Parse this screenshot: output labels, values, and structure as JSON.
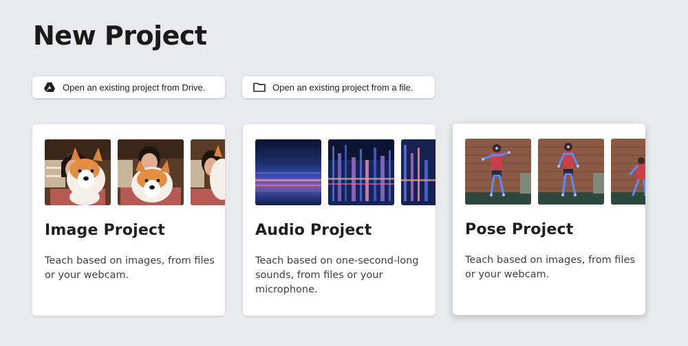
{
  "page": {
    "title": "New Project"
  },
  "actions": {
    "drive_label": "Open an existing project from Drive.",
    "file_label": "Open an existing project from a file."
  },
  "icons": {
    "drive": "google-drive-icon",
    "file": "folder-icon"
  },
  "projects": [
    {
      "title": "Image Project",
      "description": "Teach based on images, from files or your webcam."
    },
    {
      "title": "Audio Project",
      "description": "Teach based on one-second-long sounds, from files or your microphone."
    },
    {
      "title": "Pose Project",
      "description": "Teach based on images, from files or your webcam."
    }
  ],
  "colors": {
    "background": "#e8eaed",
    "card": "#ffffff",
    "text": "#1f1f1f"
  }
}
